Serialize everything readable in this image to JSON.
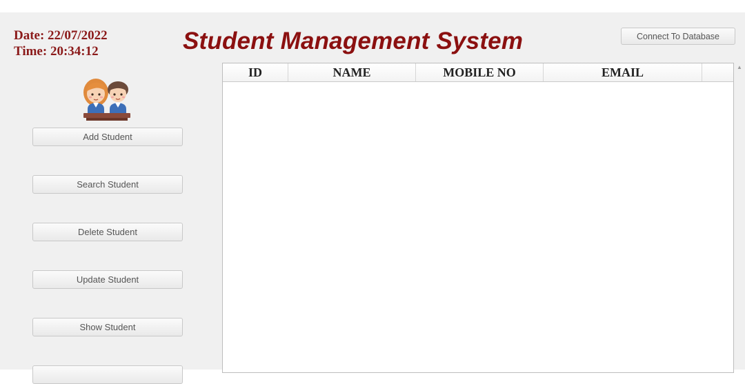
{
  "header": {
    "date": "Date: 22/07/2022",
    "time": "Time: 20:34:12",
    "title": "Student Management System",
    "connect_label": "Connect To Database"
  },
  "sidebar": {
    "buttons": [
      {
        "label": "Add Student"
      },
      {
        "label": "Search Student"
      },
      {
        "label": "Delete Student"
      },
      {
        "label": "Update Student"
      },
      {
        "label": "Show Student"
      },
      {
        "label": ""
      }
    ]
  },
  "table": {
    "columns": [
      "ID",
      "NAME",
      "MOBILE NO",
      "EMAIL"
    ],
    "rows": []
  },
  "colors": {
    "title": "#8b1010",
    "datetime": "#8b1a1a",
    "window_bg": "#f0f0f0"
  }
}
